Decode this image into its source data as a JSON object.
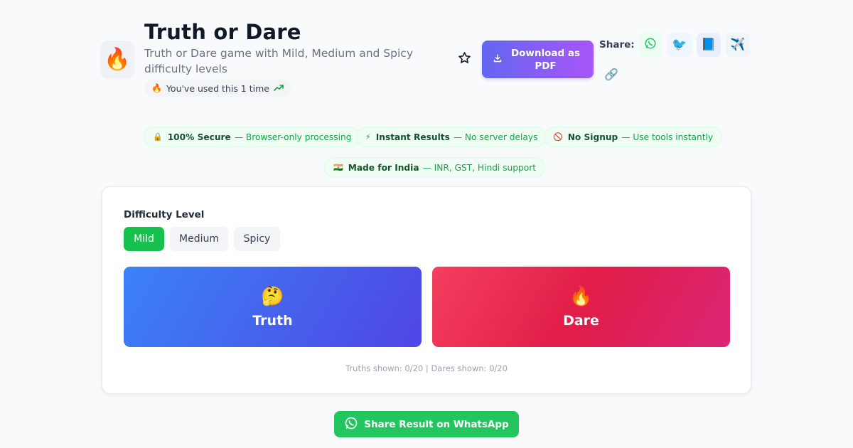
{
  "header": {
    "app_icon": "🔥",
    "title": "Truth or Dare",
    "subtitle": "Truth or Dare game with Mild, Medium and Spicy difficulty levels",
    "usage": {
      "icon": "🔥",
      "text": "You've used this 1 time",
      "trend_icon": "trending-up-icon"
    },
    "favorite_icon": "star-icon",
    "download": {
      "label": "Download as PDF",
      "icon": "download-icon"
    },
    "share": {
      "label": "Share:",
      "whatsapp": "💬",
      "twitter": "🐦",
      "facebook": "📘",
      "telegram": "✈️",
      "link": "🔗"
    }
  },
  "badges": [
    {
      "icon": "🔒",
      "title": "100% Secure",
      "desc": "— Browser-only processing"
    },
    {
      "icon": "⚡",
      "title": "Instant Results",
      "desc": "— No server delays"
    },
    {
      "icon": "🚫",
      "title": "No Signup",
      "desc": "— Use tools instantly"
    },
    {
      "icon": "🇮🇳",
      "title": "Made for India",
      "desc": "— INR, GST, Hindi support"
    }
  ],
  "game": {
    "difficulty_label": "Difficulty Level",
    "difficulties": [
      "Mild",
      "Medium",
      "Spicy"
    ],
    "selected_difficulty": "Mild",
    "truth": {
      "emoji": "🤔",
      "label": "Truth"
    },
    "dare": {
      "emoji": "🔥",
      "label": "Dare"
    },
    "counts": "Truths shown: 0/20 | Dares shown: 0/20"
  },
  "share_whatsapp_label": "Share Result on WhatsApp",
  "colors": {
    "accent_green": "#22c55e",
    "truth_gradient": [
      "#3b82f6",
      "#4f46e5"
    ],
    "dare_gradient": [
      "#f43f5e",
      "#db2777"
    ],
    "download_gradient": [
      "#6366f1",
      "#a855f7"
    ]
  }
}
